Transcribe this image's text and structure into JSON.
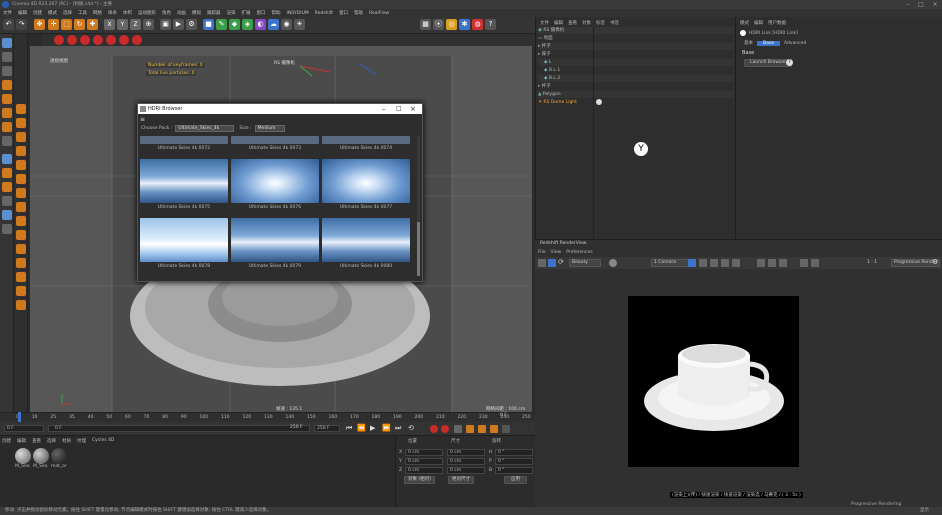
{
  "window": {
    "title": "Cinema 4D R23.207 (RC) - [材质.c4d *] - 主要",
    "icon": "c4d-logo-icon"
  },
  "menubar": [
    "文件",
    "编辑",
    "创建",
    "模式",
    "选择",
    "工具",
    "网格",
    "样条",
    "体积",
    "运动图形",
    "角色",
    "动画",
    "模拟",
    "跟踪器",
    "渲染",
    "扩展",
    "窗口",
    "帮助",
    "INSYDIUM",
    "Redshift",
    "窗口",
    "帮助",
    "RealFlow"
  ],
  "toolbar": {
    "axis_labels": [
      "X",
      "Y",
      "Z"
    ]
  },
  "toolbar2": [
    "查看",
    "摄像机",
    "显示",
    "选项",
    "过滤",
    "面板",
    "Redshift",
    "ProRender"
  ],
  "viewport": {
    "label": "透视视图",
    "hud": [
      "Number of keyframes: 0",
      "Total live particles: 0"
    ],
    "camera_label": "RS 摄像机",
    "bottom_left": "",
    "scale_label": "网格间距 : 100 cm",
    "frame_label": "帧速 : 135.1"
  },
  "hdri_browser": {
    "title": "HDRI Browser",
    "pack_label": "Choose Pack :",
    "pack_value": "Ultimate_Skies_4k",
    "size_label": "Size :",
    "size_value": "Medium",
    "items": [
      "Ultimate Skies 4k 0072",
      "Ultimate Skies 4k 0073",
      "Ultimate Skies 4k 0074",
      "Ultimate Skies 4k 0075",
      "Ultimate Skies 4k 0076",
      "Ultimate Skies 4k 0077",
      "Ultimate Skies 4k 0078",
      "Ultimate Skies 4k 0079",
      "Ultimate Skies 4k 0080"
    ]
  },
  "timeline": {
    "ticks": [
      "0",
      "10",
      "25",
      "35",
      "40",
      "50",
      "60",
      "70",
      "80",
      "90",
      "100",
      "110",
      "120",
      "130",
      "140",
      "150",
      "160",
      "170",
      "180",
      "190",
      "200",
      "210",
      "220",
      "230",
      "240",
      "250"
    ],
    "start": "0 F",
    "current": "0 F",
    "end": "250 F",
    "end2": "250 F",
    "right": "0 F"
  },
  "materials": {
    "tabs": [
      "创建",
      "编辑",
      "查看",
      "选择",
      "材质",
      "纹理",
      "Cycles 4D"
    ],
    "items": [
      {
        "name": "M_Sea"
      },
      {
        "name": "M_Sea"
      },
      {
        "name": "mat_or"
      }
    ]
  },
  "coords": {
    "headers": [
      "位置",
      "尺寸",
      "旋转"
    ],
    "rows": [
      {
        "axis": "X",
        "pos": "0 cm",
        "size": "0 cm",
        "rlabel": "H",
        "rot": "0 °"
      },
      {
        "axis": "Y",
        "pos": "0 cm",
        "size": "0 cm",
        "rlabel": "P",
        "rot": "0 °"
      },
      {
        "axis": "Z",
        "pos": "0 cm",
        "size": "0 cm",
        "rlabel": "B",
        "rot": "0 °"
      }
    ],
    "mode": "对象 (相对)",
    "size_mode": "绝对尺寸",
    "apply": "应用"
  },
  "object_manager": {
    "tabs": [
      "文件",
      "编辑",
      "查看",
      "对象",
      "标签",
      "书签"
    ],
    "objects": [
      {
        "name": "RS 摄像机",
        "color": "#bbbbbb"
      },
      {
        "name": "地面",
        "color": "#bbbbbb"
      },
      {
        "name": "杯子",
        "color": "#bbbbbb"
      },
      {
        "name": "碟子",
        "color": "#bbbbbb"
      },
      {
        "name": "L",
        "color": "#bbbbbb"
      },
      {
        "name": "B.L.1",
        "color": "#bbbbbb"
      },
      {
        "name": "B.L.2",
        "color": "#bbbbbb"
      },
      {
        "name": "杯子",
        "color": "#bbbbbb"
      },
      {
        "name": "Polygon",
        "color": "#bbbbbb"
      },
      {
        "name": "RS Dome Light",
        "color": "#ffa030"
      }
    ]
  },
  "attributes": {
    "tabs": [
      "模式",
      "编辑",
      "用户数据"
    ],
    "object_name": "HDRI Link [HDRI Link]",
    "subtabs": [
      "基本",
      "Base",
      "Advanced"
    ],
    "section": "Base",
    "launch_button": "Launch Browser"
  },
  "render_view": {
    "title": "Redshift RenderView",
    "menu": [
      "File",
      "View",
      "Preferences"
    ],
    "beauty": "Beauty",
    "camera": "1 Camera",
    "zoom": "1 : 1",
    "mode": "Progressive Render",
    "footer_items": [
      "Progressive Rendering"
    ],
    "caption": "(渲染上)(传) / 快速渲染 / 快速渲染 / 渲染选 / 马赛克 / ( 3 : 5s )"
  },
  "status": {
    "text": "移动: 点击并拖动鼠标移动元素。按住 SHIFT 键量化移动; 节点编辑模式时按住 SHIFT 键增加选择对象; 按住 CTRL 键减少选择对象。",
    "right": "显示"
  },
  "colors": {
    "accent_red": "#c92a2a",
    "orange": "#e09020",
    "blue": "#3b74c9"
  }
}
